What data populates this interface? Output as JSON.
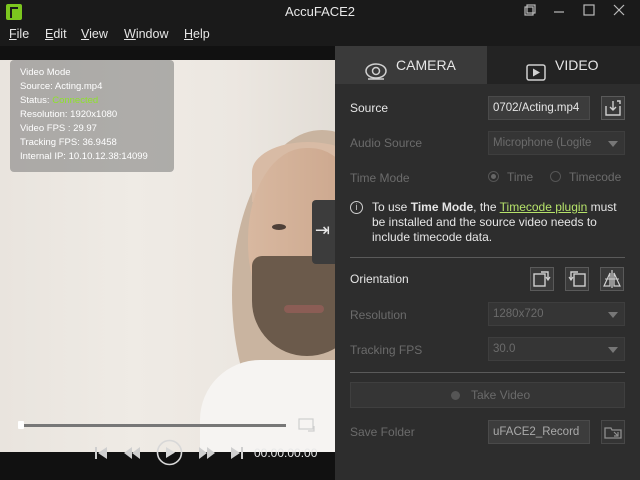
{
  "window": {
    "title": "AccuFACE2"
  },
  "menu": {
    "items": [
      {
        "mn": "F",
        "rest": "ile"
      },
      {
        "mn": "E",
        "rest": "dit"
      },
      {
        "mn": "V",
        "rest": "iew"
      },
      {
        "mn": "W",
        "rest": "indow"
      },
      {
        "mn": "H",
        "rest": "elp"
      }
    ]
  },
  "info": {
    "mode": "Video Mode",
    "source": "Source: Acting.mp4",
    "status_prefix": "Status: ",
    "status_value": "Connected",
    "resolution": "Resolution: 1920x1080",
    "video_fps": "Video FPS : 29.97",
    "tracking_fps": "Tracking FPS: 36.9458",
    "internal_ip": "Internal IP: 10.10.12.38:14099"
  },
  "playback": {
    "timecode": "00:00:00:00",
    "progress": 0
  },
  "tabs": {
    "camera": "CAMERA",
    "video": "VIDEO"
  },
  "settings": {
    "source_label": "Source",
    "source_value": "0702/Acting.mp4",
    "audio_label": "Audio Source",
    "audio_value": "Microphone (Logite",
    "timemode_label": "Time Mode",
    "time_option": "Time",
    "timecode_option": "Timecode",
    "notice_pre": "To use ",
    "notice_bold": "Time Mode",
    "notice_mid": ", the ",
    "notice_link": "Timecode plugin",
    "notice_post": " must be installed and the source video needs to include timecode data.",
    "orientation_label": "Orientation",
    "resolution_label": "Resolution",
    "resolution_value": "1280x720",
    "tracking_fps_label": "Tracking FPS",
    "tracking_fps_value": "30.0",
    "take_video": "Take Video",
    "save_folder_label": "Save Folder",
    "save_folder_value": "uFACE2_Record"
  },
  "colors": {
    "accent_green": "#8ee32a",
    "link_green": "#b6e36a",
    "panel_bg": "#2d2d2d"
  },
  "icons": [
    "app-logo-icon",
    "restore-icon",
    "minimize-icon",
    "maximize-icon",
    "close-icon",
    "camera-icon",
    "play-icon",
    "folder-open-icon",
    "info-icon",
    "rotate-cw-icon",
    "rotate-ccw-icon",
    "flip-icon",
    "skip-start-icon",
    "rewind-icon",
    "play-circle-icon",
    "fast-forward-icon",
    "skip-end-icon",
    "expand-icon",
    "panel-toggle-icon"
  ]
}
